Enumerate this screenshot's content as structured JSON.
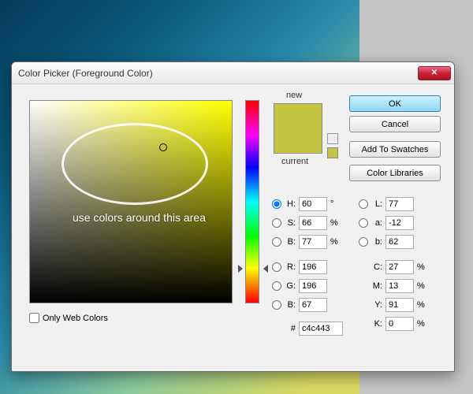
{
  "dialog": {
    "title": "Color Picker (Foreground Color)"
  },
  "buttons": {
    "ok": "OK",
    "cancel": "Cancel",
    "add_swatches": "Add To Swatches",
    "color_libraries": "Color Libraries"
  },
  "preview": {
    "new_label": "new",
    "current_label": "current",
    "new_color": "#c4c443",
    "current_color": "#c4c443"
  },
  "annotation": {
    "text": "use colors around this area"
  },
  "only_web": {
    "label": "Only Web Colors",
    "checked": false
  },
  "fields": {
    "H": {
      "label": "H:",
      "value": "60",
      "unit": "°",
      "radio": true,
      "checked": true
    },
    "S": {
      "label": "S:",
      "value": "66",
      "unit": "%",
      "radio": true,
      "checked": false
    },
    "Bv": {
      "label": "B:",
      "value": "77",
      "unit": "%",
      "radio": true,
      "checked": false
    },
    "R": {
      "label": "R:",
      "value": "196",
      "unit": "",
      "radio": true,
      "checked": false
    },
    "G": {
      "label": "G:",
      "value": "196",
      "unit": "",
      "radio": true,
      "checked": false
    },
    "Bb": {
      "label": "B:",
      "value": "67",
      "unit": "",
      "radio": true,
      "checked": false
    },
    "L": {
      "label": "L:",
      "value": "77",
      "unit": "",
      "radio": true,
      "checked": false
    },
    "a": {
      "label": "a:",
      "value": "-12",
      "unit": "",
      "radio": true,
      "checked": false
    },
    "b": {
      "label": "b:",
      "value": "62",
      "unit": "",
      "radio": true,
      "checked": false
    },
    "C": {
      "label": "C:",
      "value": "27",
      "unit": "%",
      "radio": false
    },
    "M": {
      "label": "M:",
      "value": "13",
      "unit": "%",
      "radio": false
    },
    "Y": {
      "label": "Y:",
      "value": "91",
      "unit": "%",
      "radio": false
    },
    "K": {
      "label": "K:",
      "value": "0",
      "unit": "%",
      "radio": false
    },
    "hex": {
      "label": "#",
      "value": "c4c443"
    }
  }
}
